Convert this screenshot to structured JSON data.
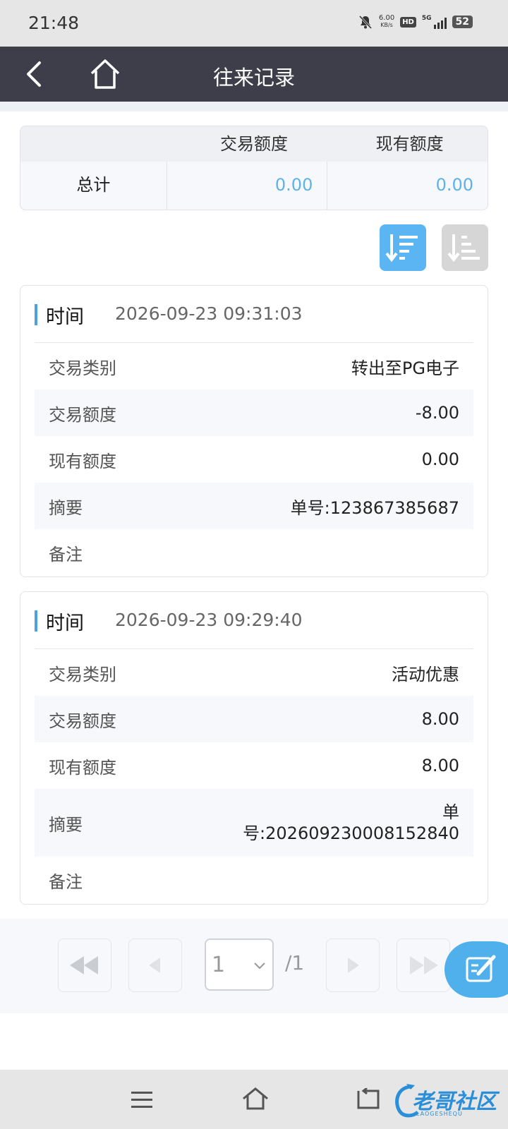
{
  "status_bar": {
    "time": "21:48",
    "net_speed": "6.00",
    "net_speed_unit": "KB/s",
    "hd_label": "HD",
    "network": "5G",
    "battery": "52"
  },
  "header": {
    "title": "往来记录"
  },
  "summary": {
    "columns": [
      "",
      "交易额度",
      "现有额度"
    ],
    "row_label": "总计",
    "trade_amount": "0.00",
    "current_amount": "0.00"
  },
  "records": [
    {
      "time_label": "时间",
      "time": "2026-09-23 09:31:03",
      "fields": [
        {
          "label": "交易类别",
          "value": "转出至PG电子"
        },
        {
          "label": "交易额度",
          "value": "-8.00"
        },
        {
          "label": "现有额度",
          "value": "0.00"
        },
        {
          "label": "摘要",
          "value": "单号:123867385687"
        },
        {
          "label": "备注",
          "value": ""
        }
      ]
    },
    {
      "time_label": "时间",
      "time": "2026-09-23 09:29:40",
      "fields": [
        {
          "label": "交易类别",
          "value": "活动优惠"
        },
        {
          "label": "交易额度",
          "value": "8.00"
        },
        {
          "label": "现有额度",
          "value": "8.00"
        },
        {
          "label": "摘要",
          "value_line1": "单",
          "value_line2": "号:202609230008152840"
        },
        {
          "label": "备注",
          "value": ""
        }
      ]
    }
  ],
  "pagination": {
    "current_page": "1",
    "total": "/1"
  },
  "watermark": {
    "text": "老哥社区",
    "sub": "LAOGESHEQU"
  },
  "colors": {
    "accent": "#5bb5f2",
    "navbar": "#3d3e4a",
    "value_blue": "#5eb3e6"
  },
  "icons": [
    "back-icon",
    "home-icon",
    "sort-desc-icon",
    "sort-asc-icon",
    "edit-icon"
  ]
}
